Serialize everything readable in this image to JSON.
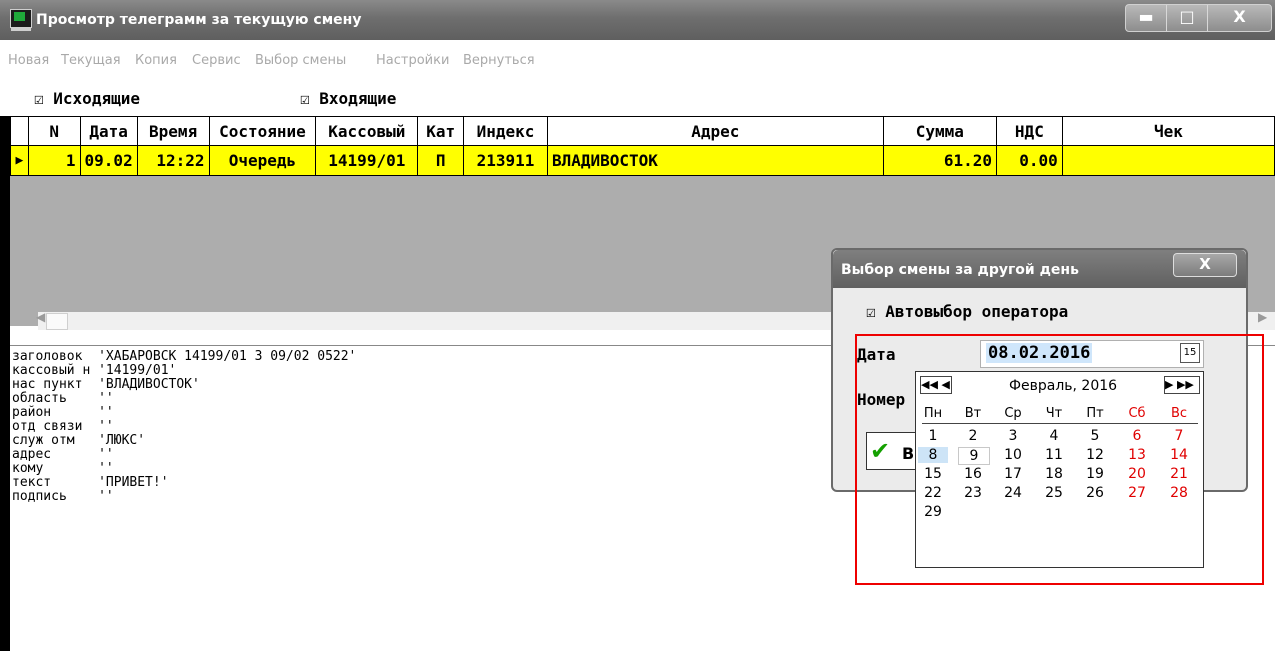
{
  "window": {
    "title": "Просмотр телеграмм за текущую смену",
    "btn_min": "▬",
    "btn_max": "□",
    "btn_close": "X"
  },
  "menu": [
    "Новая",
    "Текущая",
    "Копия",
    "Сервис",
    "Выбор смены",
    "Настройки",
    "Вернуться"
  ],
  "filters": {
    "outgoing": "Исходящие",
    "incoming": "Входящие"
  },
  "grid": {
    "headers": [
      "N",
      "Дата",
      "Время",
      "Состояние",
      "Кассовый",
      "Кат",
      "Индекс",
      "Адрес",
      "Сумма",
      "НДС",
      "Чек"
    ],
    "rows": [
      [
        "1",
        "09.02",
        "12:22",
        "Очередь",
        "14199/01",
        "П",
        "213911",
        "ВЛАДИВОСТОК",
        "61.20",
        "0.00",
        ""
      ]
    ]
  },
  "memo": [
    "заголовок  'ХАБАРОВСК 14199/01 3 09/02 0522'",
    "кассовый н '14199/01'",
    "нас пункт  'ВЛАДИВОСТОК'",
    "область    ''",
    "район      ''",
    "отд связи  ''",
    "служ отм   'ЛЮКС'",
    "адрес      ''",
    "кому       ''",
    "текст      'ПРИВЕТ!'",
    "подпись    ''"
  ],
  "dialog": {
    "title": "Выбор смены за другой день",
    "close": "X",
    "auto_operator": "Автовыбор оператора",
    "date_label": "Дата",
    "date_value": "08.02.2016",
    "number_label": "Номер",
    "ok_label_partial": "В",
    "calendar": {
      "month": "Февраль, 2016",
      "nav_prev": "◀◀ ◀",
      "nav_next": "▶ ▶▶",
      "weekdays": [
        "Пн",
        "Вт",
        "Ср",
        "Чт",
        "Пт",
        "Сб",
        "Вс"
      ],
      "selected_day": 8,
      "today_day": 9,
      "weeks": [
        [
          "1",
          "2",
          "3",
          "4",
          "5",
          "6",
          "7"
        ],
        [
          "8",
          "9",
          "10",
          "11",
          "12",
          "13",
          "14"
        ],
        [
          "15",
          "16",
          "17",
          "18",
          "19",
          "20",
          "21"
        ],
        [
          "22",
          "23",
          "24",
          "25",
          "26",
          "27",
          "28"
        ],
        [
          "29",
          "",
          "",
          "",
          "",
          "",
          ""
        ]
      ]
    }
  },
  "colors": {
    "row_highlight": "#ffff00",
    "weekend": "#e00000",
    "annotation_box": "#ee0000"
  }
}
